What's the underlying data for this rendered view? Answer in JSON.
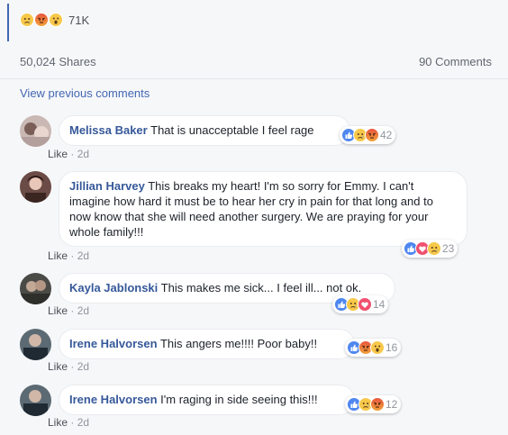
{
  "post": {
    "reaction_count": "71K",
    "top_reactions": [
      "sad-icon",
      "angry-icon",
      "wow-icon"
    ],
    "shares": "50,024 Shares",
    "comments": "90 Comments",
    "view_previous": "View previous comments"
  },
  "comments": [
    {
      "author": "Melissa Baker",
      "text": "That is unacceptable I feel rage",
      "like_label": "Like",
      "time": "2d",
      "reactions": [
        "like-icon",
        "sad-icon",
        "angry-icon"
      ],
      "reaction_count": "42"
    },
    {
      "author": "Jillian Harvey",
      "text": "This breaks my heart! I'm so sorry for Emmy. I can't imagine how hard it must be to hear her cry in pain for that long and to now know that she will need another surgery. We are praying for your whole family!!!",
      "like_label": "Like",
      "time": "2d",
      "reactions": [
        "like-icon",
        "love-icon",
        "sad-icon"
      ],
      "reaction_count": "23"
    },
    {
      "author": "Kayla Jablonski",
      "text": "This makes me sick... I feel ill... not ok.",
      "like_label": "Like",
      "time": "2d",
      "reactions": [
        "like-icon",
        "sad-icon",
        "love-icon"
      ],
      "reaction_count": "14"
    },
    {
      "author": "Irene Halvorsen",
      "text": "This angers me!!!! Poor baby!!",
      "like_label": "Like",
      "time": "2d",
      "reactions": [
        "like-icon",
        "angry-icon",
        "wow-icon"
      ],
      "reaction_count": "16"
    },
    {
      "author": "Irene Halvorsen",
      "text": "I'm raging in side seeing this!!!",
      "like_label": "Like",
      "time": "2d",
      "reactions": [
        "like-icon",
        "sad-icon",
        "angry-icon"
      ],
      "reaction_count": "12"
    }
  ],
  "meta_separator": "·"
}
